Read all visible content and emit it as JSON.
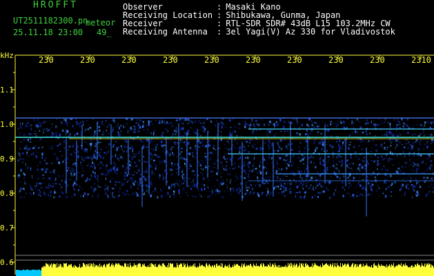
{
  "header": {
    "program": "HROFFT",
    "filename": "UT2511182300.pn",
    "mode": "meteor",
    "datetime": "25.11.18 23:00",
    "count": "49_"
  },
  "station": [
    {
      "key": "Observer",
      "sep": ":",
      "value": "Masaki Kano"
    },
    {
      "key": "Receiving Location",
      "sep": ":",
      "value": "Shibukawa, Gunma, Japan"
    },
    {
      "key": "Receiver",
      "sep": ":",
      "value": "RTL-SDR SDR# 43dB L15 103.2MHz CW"
    },
    {
      "key": "Receiving Antenna",
      "sep": ":",
      "value": "3el Yagi(V) Az 330 for Vladivostok"
    }
  ],
  "axis": {
    "unit": "kHz",
    "y_ticks": [
      "1.1",
      "1.0",
      "0.9",
      "0.8",
      "0.7",
      "0.6"
    ],
    "x_ticks": [
      "230",
      "230",
      "230",
      "230",
      "230",
      "230",
      "230",
      "230",
      "230",
      "2310"
    ]
  },
  "colors": {
    "text": "#ffffff",
    "accent": "#3fd23f",
    "axis": "#ffff3c",
    "level_bar": "#ffff3c",
    "low_bar": "#00c8ff"
  }
}
